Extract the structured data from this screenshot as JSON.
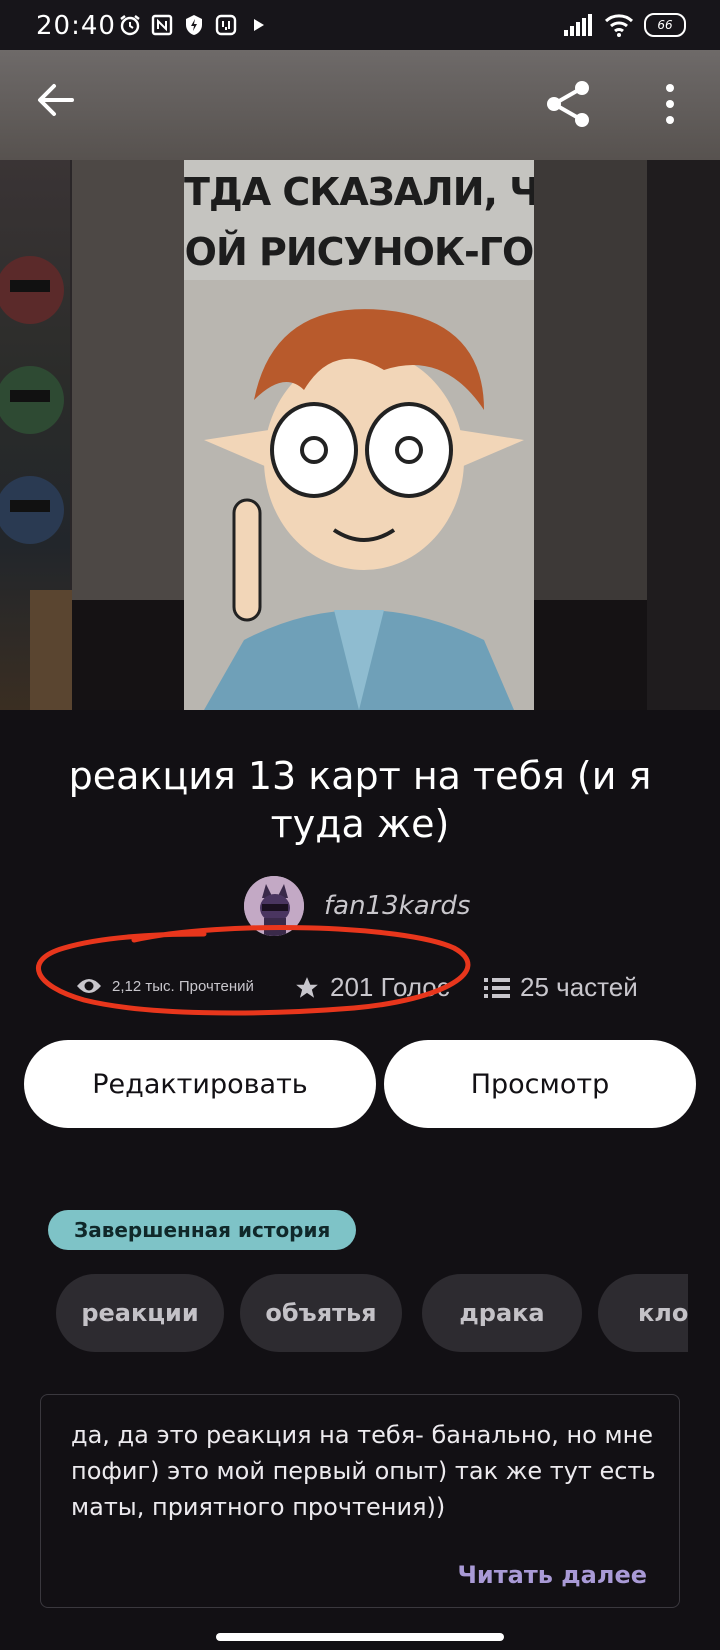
{
  "status_bar": {
    "time": "20:40",
    "battery": "66",
    "icons": [
      "alarm-icon",
      "nfc-icon",
      "shield-icon",
      "app-icon",
      "play-icon",
      "signal-icon",
      "wifi-icon",
      "battery-icon"
    ]
  },
  "cover": {
    "line1": "ТДА СКАЗАЛИ, Ч",
    "line2": "ОЙ РИСУНОК-ГО"
  },
  "story": {
    "title": "реакция 13 карт на тебя (и я туда же)",
    "author": "fan13kards",
    "views": "2,12 тыс. Прочтений",
    "votes": "201 Голос",
    "parts": "25 частей",
    "status_badge": "Завершенная история",
    "description": "да, да это реакция на тебя- банально, но мне пофиг) это мой первый опыт) так же тут есть маты, приятного прочтения))",
    "read_more": "Читать далее"
  },
  "actions": {
    "edit_label": "Редактировать",
    "view_label": "Просмотр"
  },
  "tags": [
    "реакции",
    "объятья",
    "драка",
    "клон"
  ],
  "colors": {
    "background": "#121014",
    "badge": "#7ec3c7",
    "read_more": "#a99ad6",
    "annotation": "#e8361c"
  }
}
